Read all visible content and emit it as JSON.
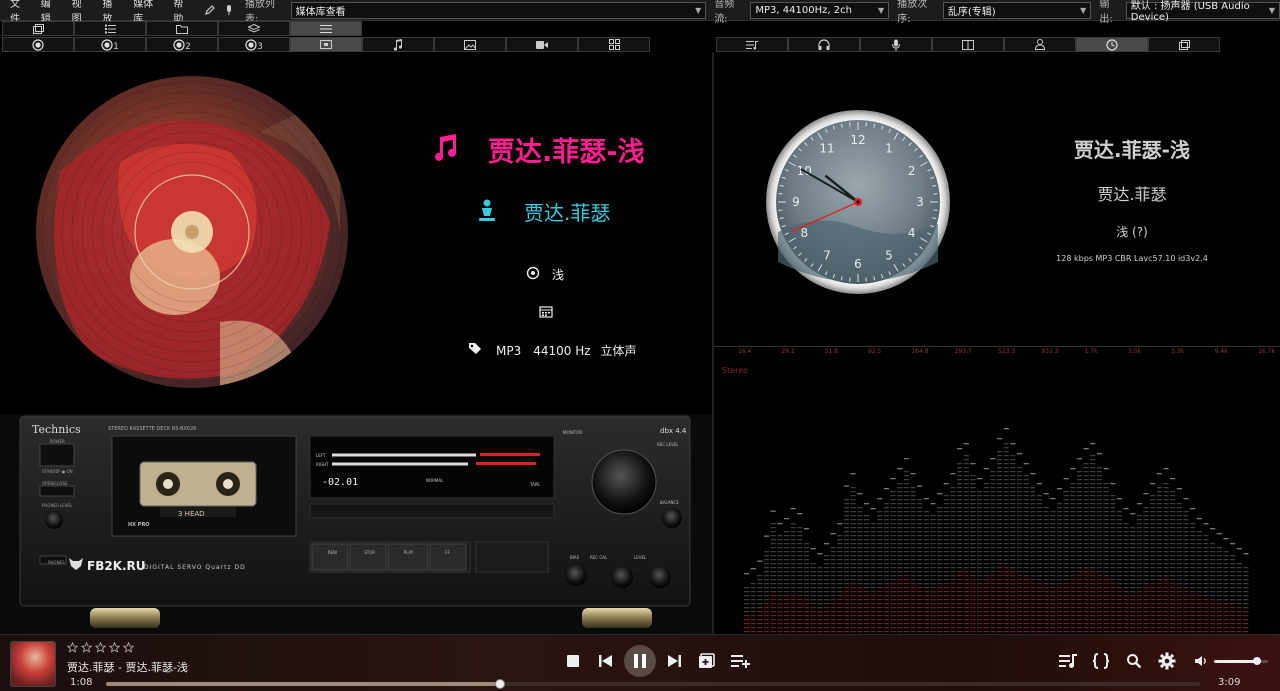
{
  "menu": [
    "文件",
    "编辑",
    "视图",
    "播放",
    "媒体库",
    "帮助"
  ],
  "toolbar": {
    "playlist_label": "播放列表:",
    "playlist_value": "媒体库查看",
    "format_label": "音频流:",
    "format_value": "MP3, 44100Hz, 2ch",
    "order_label": "播放次序:",
    "order_value": "乱序(专辑)",
    "output_label": "输出:",
    "output_value": "默认 : 扬声器 (USB Audio Device)"
  },
  "left_tabs_row1": [
    "window-icon",
    "list-icon",
    "folder-icon",
    "layers-icon",
    "menu-icon"
  ],
  "left_tabs_row2": [
    {
      "icon": "record-icon",
      "sub": ""
    },
    {
      "icon": "record-icon",
      "sub": "1"
    },
    {
      "icon": "record-icon",
      "sub": "2"
    },
    {
      "icon": "record-icon",
      "sub": "3"
    },
    {
      "icon": "screen-icon",
      "sub": ""
    },
    {
      "icon": "music-note-icon",
      "sub": ""
    },
    {
      "icon": "image-icon",
      "sub": ""
    },
    {
      "icon": "video-icon",
      "sub": ""
    },
    {
      "icon": "grid-icon",
      "sub": ""
    }
  ],
  "right_tabs": [
    "playlist-icon",
    "headphones-icon",
    "mic-icon",
    "panel-icon",
    "person-icon",
    "clock-icon",
    "window-icon"
  ],
  "track": {
    "title": "贾达.菲瑟-浅",
    "artist": "贾达.菲瑟",
    "album": "浅",
    "date": "",
    "codec": "MP3",
    "samplerate": "44100 Hz",
    "channels": "立体声"
  },
  "right_info": {
    "title": "贾达.菲瑟-浅",
    "artist": "贾达.菲瑟",
    "album": "浅 (?)",
    "tech": "128 kbps MP3 CBR Lavc57.10 id3v2.4"
  },
  "clock": {
    "numbers": [
      "12",
      "1",
      "2",
      "3",
      "4",
      "5",
      "6",
      "7",
      "8",
      "9",
      "10",
      "11"
    ],
    "hour": 10.3,
    "minute": 50,
    "second": 41
  },
  "spectrum": {
    "freq_labels": [
      "16.4",
      "29.1",
      "51.8",
      "92.5",
      "164.8",
      "293.7",
      "523.3",
      "932.3",
      "1.7k",
      "3.0k",
      "5.3k",
      "9.4k",
      "16.7k"
    ],
    "channel_label": "Stereo",
    "levels": [
      0.2,
      0.22,
      0.25,
      0.35,
      0.45,
      0.4,
      0.42,
      0.46,
      0.44,
      0.38,
      0.3,
      0.28,
      0.32,
      0.36,
      0.4,
      0.55,
      0.6,
      0.52,
      0.48,
      0.46,
      0.5,
      0.54,
      0.58,
      0.62,
      0.66,
      0.6,
      0.55,
      0.5,
      0.48,
      0.52,
      0.56,
      0.6,
      0.7,
      0.72,
      0.64,
      0.58,
      0.62,
      0.66,
      0.74,
      0.78,
      0.72,
      0.68,
      0.64,
      0.6,
      0.56,
      0.52,
      0.5,
      0.54,
      0.58,
      0.62,
      0.66,
      0.7,
      0.72,
      0.68,
      0.62,
      0.56,
      0.5,
      0.46,
      0.44,
      0.48,
      0.52,
      0.56,
      0.6,
      0.62,
      0.58,
      0.54,
      0.5,
      0.46,
      0.42,
      0.4,
      0.38,
      0.36,
      0.34,
      0.32,
      0.3,
      0.28
    ]
  },
  "deck": {
    "brand": "Technics",
    "model": "STEREO KASSETTE DECK  RS-BX626",
    "fb2k": "FB2K.RU",
    "quartz": "DIGITAL SERVO  Quartz DD",
    "head": "3 HEAD",
    "hx": "HX PRO",
    "counter": "-02.01",
    "power": "POWER",
    "standby": "STANDBY ● ON",
    "openclose": "OPEN/CLOSE",
    "phones": "PHONES",
    "phones_level": "PHONES LEVEL",
    "monitor": "MONITOR",
    "rec_level": "REC LEVEL",
    "balance": "BALANCE",
    "bias": "BIAS",
    "rec_cal": "REC CAL",
    "level": "LEVEL",
    "left": "LEFT",
    "right": "RIGHT",
    "buttons": [
      "REW",
      "STOP",
      "PLAY",
      "FF"
    ],
    "db": "dbx 4.4",
    "tape": "TAPE",
    "normal": "NORMAL"
  },
  "player": {
    "stars": 5,
    "now_playing": "贾达.菲瑟 - 贾达.菲瑟-浅",
    "elapsed": "1:08",
    "total": "3:09",
    "progress": 0.36,
    "volume": 0.8
  },
  "colors": {
    "pink": "#ff1f8f",
    "cyan": "#37c9e0",
    "red_hand": "#e02020",
    "spectrum_dim": "#3a3a3a",
    "spectrum_red": "#6a1e1e"
  }
}
